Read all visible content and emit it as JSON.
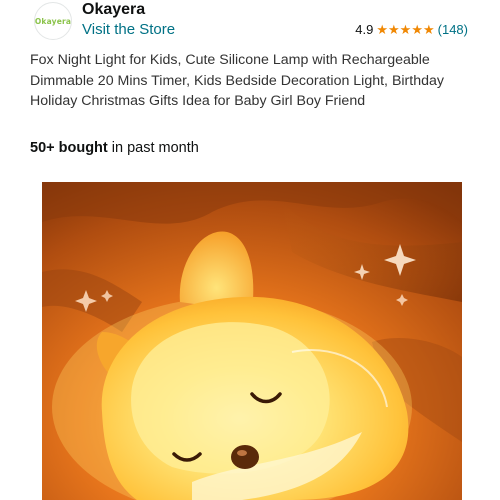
{
  "store": {
    "logo_text": "Okayera",
    "name": "Okayera",
    "link_label": "Visit the Store"
  },
  "rating": {
    "value": "4.9",
    "stars": 5,
    "count": "(148)"
  },
  "product": {
    "title": "Fox Night Light for Kids, Cute Silicone Lamp with Rechargeable Dimmable 20 Mins Timer, Kids Bedside Decoration Light, Birthday Holiday Christmas Gifts Idea for Baby Girl Boy Friend",
    "bought_count": "50+ bought",
    "bought_suffix": " in past month"
  },
  "colors": {
    "link": "#007185",
    "star": "#f08804",
    "logo_text": "#8bc34a"
  }
}
